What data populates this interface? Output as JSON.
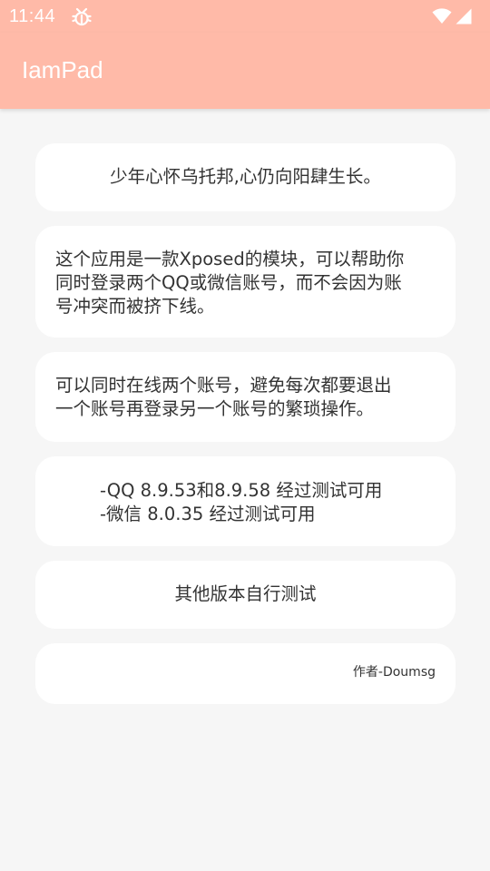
{
  "status_bar": {
    "time": "11:44",
    "bug_icon": "bug-icon",
    "wifi_icon": "wifi-icon",
    "signal_icon": "cell-signal-icon",
    "color": "#ffbaa8"
  },
  "app_bar": {
    "title": "IamPad",
    "color": "#ffbaa8"
  },
  "cards": [
    {
      "text": "少年心怀乌托邦,心仍向阳肆生长。"
    },
    {
      "text": "这个应用是一款Xposed的模块，可以帮助你\n同时登录两个QQ或微信账号，而不会因为账\n号冲突而被挤下线。"
    },
    {
      "text": "可以同时在线两个账号，避免每次都要退出\n一个账号再登录另一个账号的繁琐操作。"
    },
    {
      "text": "-QQ 8.9.53和8.9.58 经过测试可用\n-微信 8.0.35 经过测试可用"
    },
    {
      "text": "其他版本自行测试"
    },
    {
      "text": "作者-Doumsg"
    }
  ]
}
